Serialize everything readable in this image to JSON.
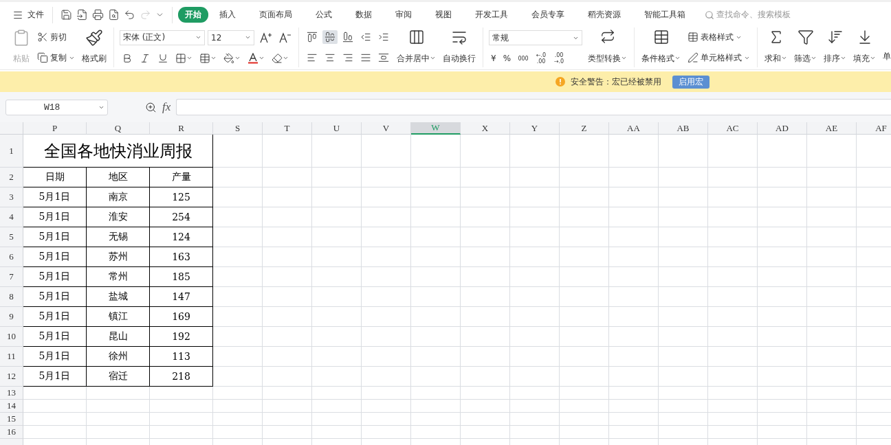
{
  "menu": {
    "file_label": "文件",
    "tabs": [
      {
        "label": "开始",
        "selected": true
      },
      {
        "label": "插入",
        "selected": false
      },
      {
        "label": "页面布局",
        "selected": false
      },
      {
        "label": "公式",
        "selected": false
      },
      {
        "label": "数据",
        "selected": false
      },
      {
        "label": "审阅",
        "selected": false
      },
      {
        "label": "视图",
        "selected": false
      },
      {
        "label": "开发工具",
        "selected": false
      },
      {
        "label": "会员专享",
        "selected": false
      },
      {
        "label": "稻壳资源",
        "selected": false
      },
      {
        "label": "智能工具箱",
        "selected": false
      }
    ],
    "search_placeholder": "查找命令、搜索模板"
  },
  "ribbon": {
    "paste": {
      "label": "粘贴",
      "disabled": true
    },
    "cut": "剪切",
    "copy": "复制",
    "format_painter": "格式刷",
    "font_name": "宋体 (正文)",
    "font_size": "12",
    "vertical_align": [
      {
        "selected": false
      },
      {
        "selected": true
      },
      {
        "selected": false
      }
    ],
    "merge": "合并居中",
    "wrap": "自动换行",
    "number_format": "常规",
    "currency": "¥",
    "percent": "%",
    "thousands": "000",
    "inc_decimal": "←.0 .00",
    "dec_decimal": ".00 →.0",
    "convert": "类型转换",
    "conditional": "条件格式",
    "table_style": "表格样式",
    "cell_style": "单元格样式",
    "sum": "求和",
    "filter": "筛选",
    "sort": "排序",
    "fill": "填充",
    "cut_off": "单"
  },
  "banner": {
    "message": "安全警告：宏已经被禁用",
    "button": "启用宏"
  },
  "formula_bar": {
    "name_box": "W18",
    "fx_label": "fx"
  },
  "sheet": {
    "columns": [
      {
        "label": "P",
        "selected": false
      },
      {
        "label": "Q",
        "selected": false
      },
      {
        "label": "R",
        "selected": false
      },
      {
        "label": "S",
        "selected": false
      },
      {
        "label": "T",
        "selected": false
      },
      {
        "label": "U",
        "selected": false
      },
      {
        "label": "V",
        "selected": false
      },
      {
        "label": "W",
        "selected": true
      },
      {
        "label": "X",
        "selected": false
      },
      {
        "label": "Y",
        "selected": false
      },
      {
        "label": "Z",
        "selected": false
      },
      {
        "label": "AA",
        "selected": false
      },
      {
        "label": "AB",
        "selected": false
      },
      {
        "label": "AC",
        "selected": false
      },
      {
        "label": "AD",
        "selected": false
      },
      {
        "label": "AE",
        "selected": false
      },
      {
        "label": "AF",
        "selected": false
      }
    ],
    "row_numbers": [
      "1",
      "2",
      "3",
      "4",
      "5",
      "6",
      "7",
      "8",
      "9",
      "10",
      "11",
      "12",
      "13",
      "14",
      "15",
      "16"
    ],
    "title": "全国各地快消业周报",
    "header": [
      "日期",
      "地区",
      "产量"
    ],
    "rows": [
      [
        "5月1日",
        "南京",
        "125"
      ],
      [
        "5月1日",
        "淮安",
        "254"
      ],
      [
        "5月1日",
        "无锡",
        "124"
      ],
      [
        "5月1日",
        "苏州",
        "163"
      ],
      [
        "5月1日",
        "常州",
        "185"
      ],
      [
        "5月1日",
        "盐城",
        "147"
      ],
      [
        "5月1日",
        "镇江",
        "169"
      ],
      [
        "5月1日",
        "昆山",
        "192"
      ],
      [
        "5月1日",
        "徐州",
        "113"
      ],
      [
        "5月1日",
        "宿迁",
        "218"
      ]
    ]
  }
}
